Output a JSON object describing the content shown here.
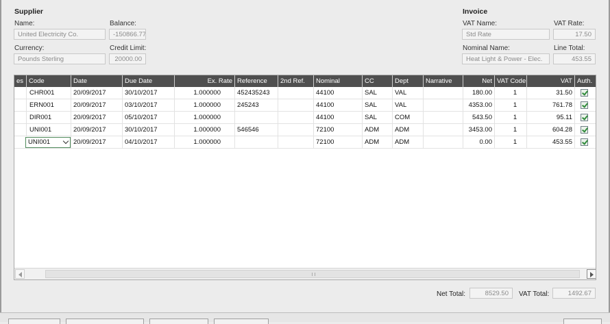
{
  "supplier": {
    "title": "Supplier",
    "name_label": "Name:",
    "name_value": "United Electricity Co.",
    "balance_label": "Balance:",
    "balance_value": "-150866.77",
    "currency_label": "Currency:",
    "currency_value": "Pounds Sterling",
    "credit_limit_label": "Credit Limit:",
    "credit_limit_value": "20000.00"
  },
  "invoice": {
    "title": "Invoice",
    "vat_name_label": "VAT Name:",
    "vat_name_value": "Std Rate",
    "vat_rate_label": "VAT Rate:",
    "vat_rate_value": "17.50",
    "nominal_name_label": "Nominal Name:",
    "nominal_name_value": "Heat Light & Power - Elec.",
    "line_total_label": "Line Total:",
    "line_total_value": "453.55"
  },
  "grid": {
    "columns": [
      "es",
      "Code",
      "Date",
      "Due Date",
      "Ex. Rate",
      "Reference",
      "2nd Ref.",
      "Nominal",
      "CC",
      "Dept",
      "Narrative",
      "Net",
      "VAT Code",
      "VAT",
      "Auth."
    ],
    "rows": [
      {
        "code": "CHR001",
        "date": "20/09/2017",
        "due_date": "30/10/2017",
        "ex_rate": "1.000000",
        "reference": "452435243",
        "ref2": "",
        "nominal": "44100",
        "cc": "SAL",
        "dept": "VAL",
        "narrative": "",
        "net": "180.00",
        "vat_code": "1",
        "vat": "31.50",
        "auth": true
      },
      {
        "code": "ERN001",
        "date": "20/09/2017",
        "due_date": "03/10/2017",
        "ex_rate": "1.000000",
        "reference": "245243",
        "ref2": "",
        "nominal": "44100",
        "cc": "SAL",
        "dept": "VAL",
        "narrative": "",
        "net": "4353.00",
        "vat_code": "1",
        "vat": "761.78",
        "auth": true
      },
      {
        "code": "DIR001",
        "date": "20/09/2017",
        "due_date": "05/10/2017",
        "ex_rate": "1.000000",
        "reference": "",
        "ref2": "",
        "nominal": "44100",
        "cc": "SAL",
        "dept": "COM",
        "narrative": "",
        "net": "543.50",
        "vat_code": "1",
        "vat": "95.11",
        "auth": true
      },
      {
        "code": "UNI001",
        "date": "20/09/2017",
        "due_date": "30/10/2017",
        "ex_rate": "1.000000",
        "reference": "546546",
        "ref2": "",
        "nominal": "72100",
        "cc": "ADM",
        "dept": "ADM",
        "narrative": "",
        "net": "3453.00",
        "vat_code": "1",
        "vat": "604.28",
        "auth": true
      },
      {
        "code": "UNI001",
        "date": "20/09/2017",
        "due_date": "04/10/2017",
        "ex_rate": "1.000000",
        "reference": "",
        "ref2": "",
        "nominal": "72100",
        "cc": "ADM",
        "dept": "ADM",
        "narrative": "",
        "net": "0.00",
        "vat_code": "1",
        "vat": "453.55",
        "auth": true
      }
    ]
  },
  "totals": {
    "net_label": "Net Total:",
    "net_value": "8529.50",
    "vat_label": "VAT Total:",
    "vat_value": "1492.67"
  },
  "colors": {
    "header_bg": "#4f4f4f",
    "check_green": "#2f8a3a"
  }
}
